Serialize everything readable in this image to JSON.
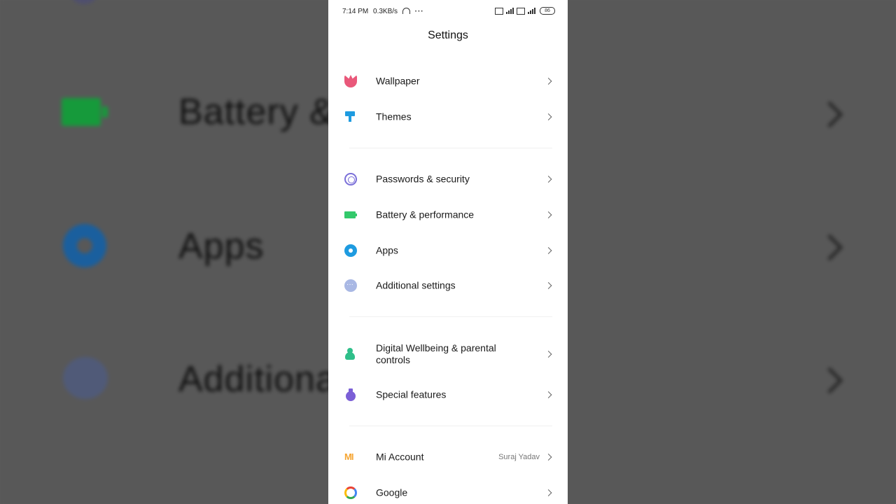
{
  "background": {
    "texts": [
      "Battery &",
      "Apps",
      "Additiona"
    ]
  },
  "status_bar": {
    "time": "7:14 PM",
    "speed": "0.3KB/s",
    "more": "···",
    "battery": "86"
  },
  "header": {
    "title": "Settings"
  },
  "sections": [
    {
      "items": [
        {
          "label": "Wallpaper",
          "icon": "wallpaper-icon"
        },
        {
          "label": "Themes",
          "icon": "themes-icon"
        }
      ]
    },
    {
      "items": [
        {
          "label": "Passwords & security",
          "icon": "fingerprint-icon"
        },
        {
          "label": "Battery & performance",
          "icon": "battery-icon"
        },
        {
          "label": "Apps",
          "icon": "gear-icon"
        },
        {
          "label": "Additional settings",
          "icon": "more-icon"
        }
      ]
    },
    {
      "items": [
        {
          "label": "Digital Wellbeing & parental controls",
          "icon": "wellbeing-icon"
        },
        {
          "label": "Special features",
          "icon": "special-icon"
        }
      ]
    },
    {
      "items": [
        {
          "label": "Mi Account",
          "value": "Suraj Yadav",
          "icon": "mi-icon"
        },
        {
          "label": "Google",
          "icon": "google-icon"
        }
      ]
    }
  ],
  "icon_glyphs": {
    "mi": "MI"
  },
  "colors": {
    "wallpaper": "#e9587a",
    "themes": "#1e9be0",
    "security": "#7a6fd8",
    "battery": "#33c96b",
    "apps": "#1e9be0",
    "additional": "#a9b8e4",
    "wellbeing": "#2fbf8a",
    "special": "#7b5fd6",
    "mi": "#f6a532"
  }
}
